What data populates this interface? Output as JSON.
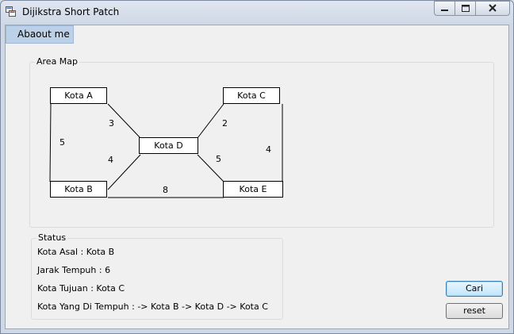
{
  "window": {
    "title": "Dijikstra Short Patch"
  },
  "menu": {
    "items": [
      {
        "label": "Abaout me"
      }
    ]
  },
  "area_map": {
    "label": "Area Map",
    "nodes": {
      "a": "Kota A",
      "b": "Kota B",
      "c": "Kota C",
      "d": "Kota D",
      "e": "Kota E"
    },
    "weights": {
      "ad": "3",
      "ab": "5",
      "bd": "4",
      "cd": "2",
      "ce": "4",
      "de": "5",
      "be": "8"
    }
  },
  "status": {
    "label": "Status",
    "origin": "Kota Asal : Kota B",
    "distance": "Jarak Tempuh :   6",
    "destination": "Kota Tujuan : Kota C",
    "path": "Kota Yang Di Tempuh :  -> Kota B -> Kota D -> Kota C"
  },
  "buttons": {
    "search": "Cari",
    "reset": "reset"
  }
}
